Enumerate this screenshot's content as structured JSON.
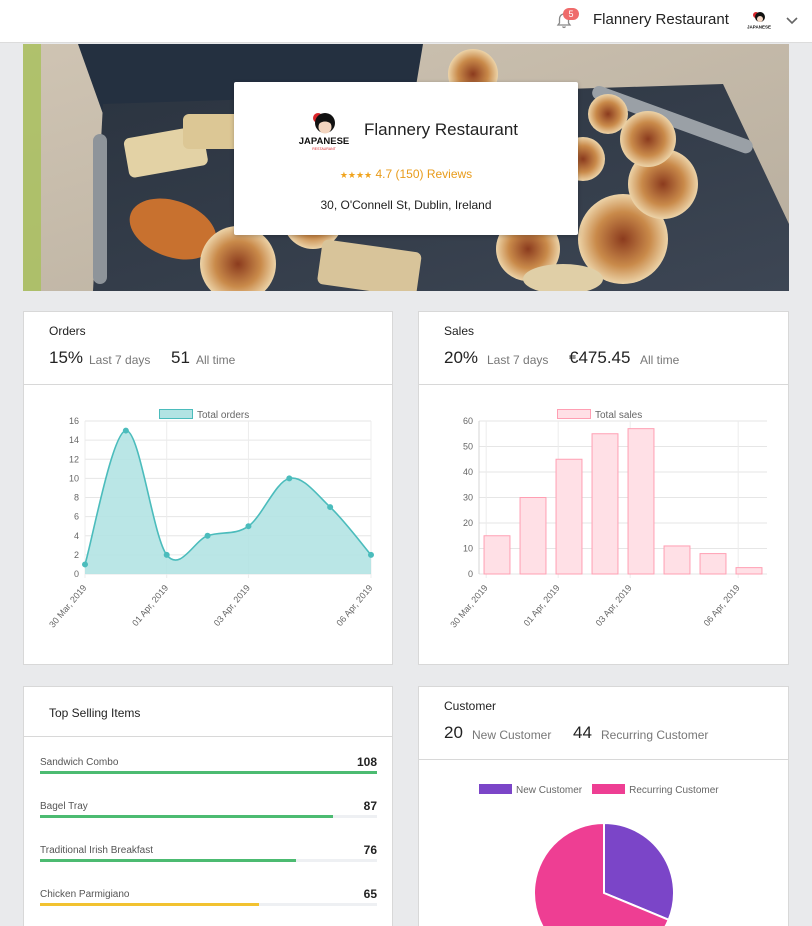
{
  "topbar": {
    "notification_count": "5",
    "restaurant_name": "Flannery Restaurant",
    "logo_text": "JAPANESE"
  },
  "hero": {
    "restaurant_name": "Flannery Restaurant",
    "logo_text": "JAPANESE",
    "logo_subtext": "RESTAURANT",
    "stars": "★★★★",
    "rating": "4.7",
    "reviews": "(150) Reviews",
    "address": "30, O'Connell St, Dublin, Ireland"
  },
  "orders": {
    "title": "Orders",
    "stat1_value": "15%",
    "stat1_label": "Last 7 days",
    "stat2_value": "51",
    "stat2_label": "All time"
  },
  "sales": {
    "title": "Sales",
    "stat1_value": "20%",
    "stat1_label": "Last 7 days",
    "stat2_value": "€475.45",
    "stat2_label": "All time"
  },
  "top_selling": {
    "title": "Top Selling Items",
    "items": [
      {
        "name": "Sandwich Combo",
        "value": "108",
        "fraction": 1.0,
        "color": "#4cbb71"
      },
      {
        "name": "Bagel Tray",
        "value": "87",
        "fraction": 0.87,
        "color": "#4cbb71"
      },
      {
        "name": "Traditional Irish Breakfast",
        "value": "76",
        "fraction": 0.76,
        "color": "#4cbb71"
      },
      {
        "name": "Chicken Parmigiano",
        "value": "65",
        "fraction": 0.65,
        "color": "#f2c230"
      }
    ]
  },
  "customer": {
    "title": "Customer",
    "stat1_value": "20",
    "stat1_label": "New Customer",
    "stat2_value": "44",
    "stat2_label": "Recurring Customer"
  },
  "colors": {
    "orders_fill": "#b2e3e3",
    "orders_line": "#4bbcbc",
    "sales_fill": "#ffe0e6",
    "sales_line": "#ff9fb3",
    "new_customer": "#7b45c8",
    "recurring_customer": "#ee3e93"
  },
  "chart_data": [
    {
      "type": "area",
      "legend": [
        "Total orders"
      ],
      "x": [
        "30 Mar, 2019",
        "31 Mar, 2019",
        "01 Apr, 2019",
        "02 Apr, 2019",
        "03 Apr, 2019",
        "04 Apr, 2019",
        "05 Apr, 2019",
        "06 Apr, 2019"
      ],
      "xticks_shown": [
        "30 Mar, 2019",
        "01 Apr, 2019",
        "03 Apr, 2019",
        "06 Apr, 2019"
      ],
      "series": [
        {
          "name": "Total orders",
          "values": [
            1,
            15,
            2,
            4,
            5,
            10,
            7,
            2
          ]
        }
      ],
      "ylim": [
        0,
        16
      ],
      "yticks": [
        0,
        2,
        4,
        6,
        8,
        10,
        12,
        14,
        16
      ],
      "grid": true,
      "legend_position": "top"
    },
    {
      "type": "bar",
      "legend": [
        "Total sales"
      ],
      "x": [
        "30 Mar, 2019",
        "31 Mar, 2019",
        "01 Apr, 2019",
        "02 Apr, 2019",
        "03 Apr, 2019",
        "04 Apr, 2019",
        "05 Apr, 2019",
        "06 Apr, 2019"
      ],
      "xticks_shown": [
        "30 Mar, 2019",
        "01 Apr, 2019",
        "03 Apr, 2019",
        "06 Apr, 2019"
      ],
      "series": [
        {
          "name": "Total sales",
          "values": [
            15,
            30,
            45,
            55,
            57,
            11,
            8,
            2.5
          ]
        }
      ],
      "ylim": [
        0,
        60
      ],
      "yticks": [
        0,
        10,
        20,
        30,
        40,
        50,
        60
      ],
      "grid": true,
      "legend_position": "top"
    },
    {
      "type": "pie",
      "legend": [
        "New Customer",
        "Recurring Customer"
      ],
      "series": [
        {
          "values": [
            20,
            44
          ]
        }
      ],
      "legend_position": "top"
    }
  ]
}
